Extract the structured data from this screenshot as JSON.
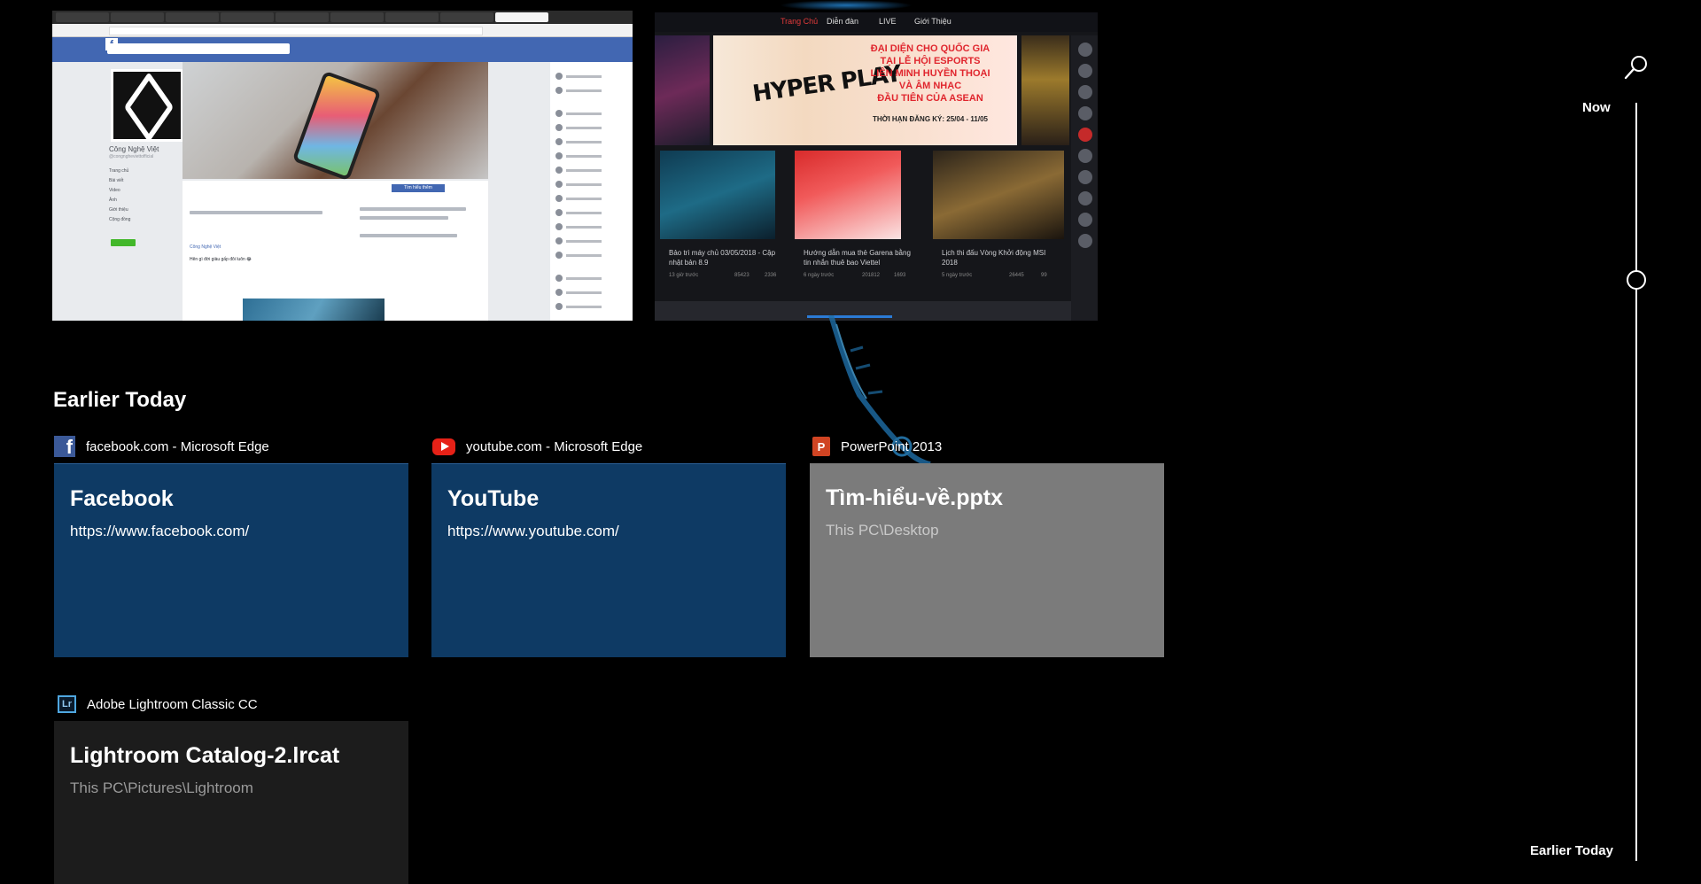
{
  "window_thumbnails": {
    "facebook": {
      "page_name": "Công Nghệ Việt",
      "handle": "@congngheviettofficial",
      "nav_items": [
        "Trang chủ",
        "Bài viết",
        "Video",
        "Ảnh",
        "Giới thiệu",
        "Cộng đồng"
      ],
      "button": "Tìm hiểu thêm",
      "post_author": "Công Nghệ Việt",
      "post_text": "Hên gì đời giàu gấp đôi luôn 😂"
    },
    "game": {
      "nav": [
        "Trang Chủ",
        "Diễn đàn",
        "LIVE",
        "Giới Thiệu"
      ],
      "banner_brand": "HYPER PLAY",
      "banner_headline": [
        "ĐẠI DIỆN CHO QUỐC GIA",
        "TẠI LỄ HỘI ESPORTS",
        "LIÊN MINH HUYỀN THOẠI",
        "VÀ ÂM NHẠC",
        "ĐẦU TIÊN CỦA ASEAN"
      ],
      "banner_deadline": "THỜI HẠN ĐĂNG KÝ: 25/04 - 11/05",
      "articles": [
        {
          "title": "Bảo trì máy chủ 03/05/2018 - Cập nhật bản 8.9",
          "time": "13 giờ trước",
          "views": "85423",
          "comments": "2336"
        },
        {
          "title": "Hướng dẫn mua thẻ Garena bằng tin nhắn thuê bao Viettel",
          "time": "6 ngày trước",
          "views": "201812",
          "comments": "1693"
        },
        {
          "title": "Lịch thi đấu Vòng Khởi động MSI 2018",
          "time": "5 ngày trước",
          "views": "26445",
          "comments": "99"
        }
      ]
    }
  },
  "section_heading": "Earlier Today",
  "activities": [
    {
      "app_name": "facebook.com - Microsoft Edge",
      "icon": "facebook-icon",
      "title": "Facebook",
      "subtitle": "https://www.facebook.com/",
      "color": "#0e3a64"
    },
    {
      "app_name": "youtube.com - Microsoft Edge",
      "icon": "youtube-icon",
      "title": "YouTube",
      "subtitle": "https://www.youtube.com/",
      "color": "#0e3a64"
    },
    {
      "app_name": "PowerPoint 2013",
      "icon": "powerpoint-icon",
      "title": "Tìm-hiểu-về.pptx",
      "subtitle": "This PC\\Desktop",
      "color": "#7b7b7b"
    },
    {
      "app_name": "Adobe Lightroom Classic CC",
      "icon": "lightroom-icon",
      "title": "Lightroom Catalog-2.lrcat",
      "subtitle": "This PC\\Pictures\\Lightroom",
      "color": "#1c1c1c"
    }
  ],
  "timeline": {
    "top_label": "Now",
    "bottom_label": "Earlier Today",
    "search_icon": "search-icon"
  }
}
